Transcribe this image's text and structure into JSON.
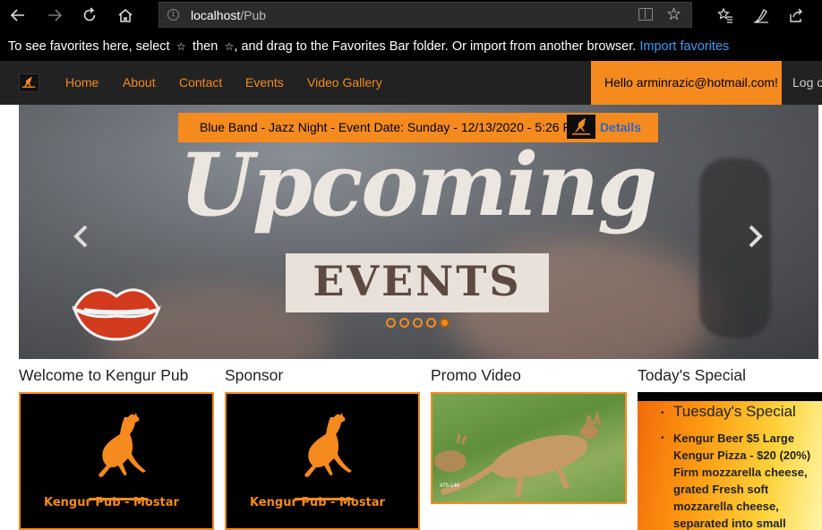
{
  "browser": {
    "url_host": "localhost",
    "url_path": "/Pub",
    "favorites_message_a": "To see favorites here, select",
    "favorites_message_b": "then",
    "favorites_message_c": ", and drag to the Favorites Bar folder. Or import from another browser.",
    "import_link": "Import favorites"
  },
  "nav": {
    "items": [
      "Home",
      "About",
      "Contact",
      "Events",
      "Video Gallery"
    ],
    "greeting": "Hello arminrazic@hotmail.com!",
    "logout": "Log off"
  },
  "carousel": {
    "event_text": "Blue Band - Jazz Night - Event Date: Sunday - 12/13/2020 - 5:26 PM",
    "details_link": "Details",
    "headline": "Upcoming",
    "subheadline": "EVENTS",
    "slide_count": 5,
    "active_slide": 5
  },
  "columns": {
    "welcome_title": "Welcome to Kengur Pub",
    "welcome_logo_text": "Kengur Pub - Mostar",
    "sponsor_title": "Sponsor",
    "sponsor_logo_text": "Kengur Pub - Mostar",
    "promo_title": "Promo Video",
    "promo_tag": "475-146",
    "special_title": "Today's Special",
    "special_heading": "Tuesday's Special",
    "special_lines": [
      "Kengur Beer $5 Large",
      "Kengur Pizza - $20 (20%)",
      "Firm mozzarella cheese,",
      "grated Fresh soft",
      "mozzarella cheese,",
      "separated into small"
    ]
  },
  "colors": {
    "accent": "#f58b1f",
    "navbar": "#222222",
    "details_link": "#2e63c8",
    "favorites_link": "#3b9cf0"
  }
}
